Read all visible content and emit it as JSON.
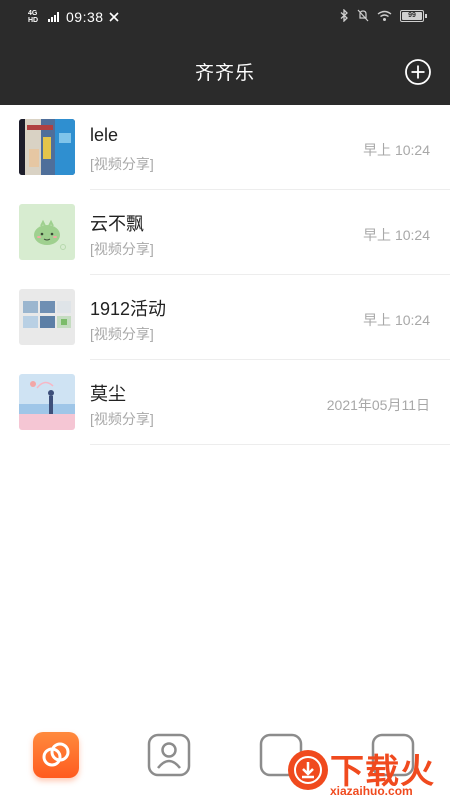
{
  "status_bar": {
    "network": "4G HD",
    "time": "09:38",
    "battery": "99"
  },
  "header": {
    "title": "齐齐乐",
    "add_icon": "plus-circle-icon"
  },
  "chats": [
    {
      "name": "lele",
      "preview": "[视频分享]",
      "time": "早上 10:24",
      "avatar": "photo-collage-avatar"
    },
    {
      "name": "云不飘",
      "preview": "[视频分享]",
      "time": "早上 10:24",
      "avatar": "green-cartoon-avatar"
    },
    {
      "name": "1912活动",
      "preview": "[视频分享]",
      "time": "早上 10:24",
      "avatar": "group-grid-avatar"
    },
    {
      "name": "莫尘",
      "preview": "[视频分享]",
      "time": "2021年05月11日",
      "avatar": "beach-illustration-avatar"
    }
  ],
  "tabbar": {
    "tabs": [
      "chat-rings-icon",
      "contacts-person-icon",
      "discover-icon",
      "profile-icon"
    ]
  },
  "watermark": {
    "title": "下载火",
    "url": "xiazaihuo.com"
  },
  "colors": {
    "header_bg": "#2b2b2b",
    "accent": "#ff6a2a",
    "watermark": "#f04a1e"
  }
}
